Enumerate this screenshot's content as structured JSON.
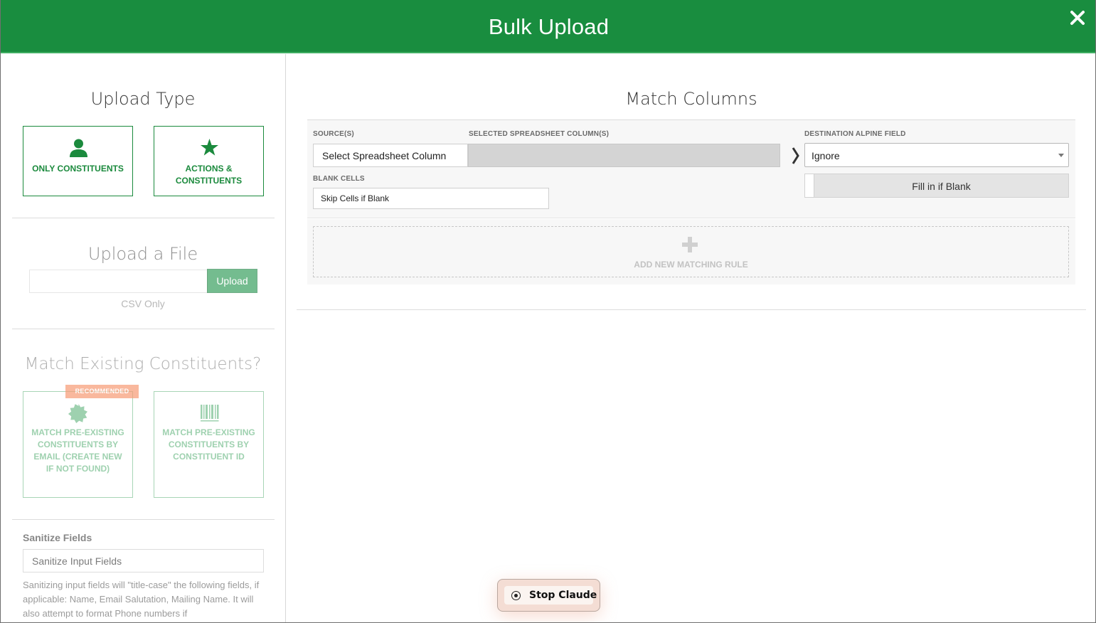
{
  "header": {
    "title": "Bulk Upload",
    "close_icon": "close-icon",
    "color": "#198d3f"
  },
  "upload_type": {
    "title": "Upload Type",
    "options": [
      {
        "label": "ONLY CONSTITUENTS",
        "icon": "user-icon"
      },
      {
        "label": "ACTIONS & CONSTITUENTS",
        "icon": "star-icon"
      }
    ]
  },
  "upload_file": {
    "title": "Upload a File",
    "button": "Upload",
    "note": "CSV Only"
  },
  "match_existing": {
    "title": "Match Existing Constituents?",
    "badge": "RECOMMENDED",
    "options": [
      {
        "label": "MATCH PRE-EXISTING CONSTITUENTS BY EMAIL (CREATE NEW IF NOT FOUND)",
        "icon": "badge-icon"
      },
      {
        "label": "MATCH PRE-EXISTING CONSTITUENTS BY CONSTITUENT ID",
        "icon": "barcode-icon"
      }
    ]
  },
  "sanitize": {
    "label": "Sanitize Fields",
    "value": "Sanitize Input Fields",
    "help": "Sanitizing input fields will \"title-case\" the following fields, if applicable: Name, Email Salutation, Mailing Name. It will also attempt to format Phone numbers if"
  },
  "match_columns": {
    "title": "Match Columns",
    "source_label": "SOURCE(S)",
    "source_value": "Select Spreadsheet Column",
    "selected_label": "SELECTED SPREADSHEET COLUMN(S)",
    "blank_label": "BLANK CELLS",
    "blank_value": "Skip Cells if Blank",
    "dest_label": "DESTINATION ALPINE FIELD",
    "dest_value": "Ignore",
    "fill_label": "Fill in if Blank",
    "add_rule": "ADD NEW MATCHING RULE"
  },
  "stop_button": {
    "label": "Stop Claude"
  }
}
